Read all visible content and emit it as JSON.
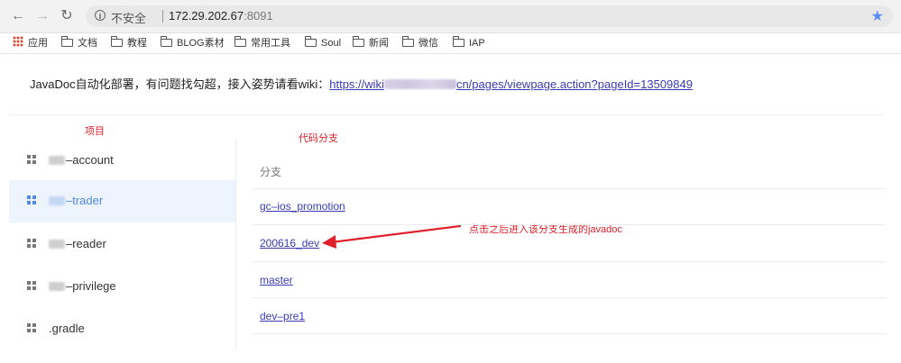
{
  "browser": {
    "security_label": "不安全",
    "host": "172.29.202.67",
    "port": ":8091",
    "icons": {
      "back": "arrow-left-icon",
      "forward": "arrow-right-icon",
      "reload": "reload-icon",
      "info": "info-icon",
      "bookmark": "star-icon"
    }
  },
  "bookmarks": [
    {
      "label": "应用"
    },
    {
      "label": "文档"
    },
    {
      "label": "教程"
    },
    {
      "label": "BLOG素材"
    },
    {
      "label": "常用工具"
    },
    {
      "label": "Soul"
    },
    {
      "label": "新闻"
    },
    {
      "label": "微信"
    },
    {
      "label": "IAP"
    }
  ],
  "intro": {
    "text": "JavaDoc自动化部署，有问题找勾超，接入姿势请看wiki：",
    "link_prefix": "https://wiki",
    "link_suffix": "cn/pages/viewpage.action?pageId=13509849"
  },
  "annotations": {
    "projects": "项目",
    "branches": "代码分支",
    "arrow_note": "点击之后进入该分支生成的javadoc",
    "accent_color": "#e0202a"
  },
  "projects": [
    {
      "suffix": "–account",
      "active": false
    },
    {
      "suffix": "–trader",
      "active": true
    },
    {
      "suffix": "–reader",
      "active": false
    },
    {
      "suffix": "–privilege",
      "active": false
    },
    {
      "suffix": ".gradle",
      "active": false
    }
  ],
  "branches": {
    "header": "分支",
    "items": [
      "gc–ios_promotion",
      "200616_dev",
      "master",
      "dev–pre1"
    ]
  }
}
